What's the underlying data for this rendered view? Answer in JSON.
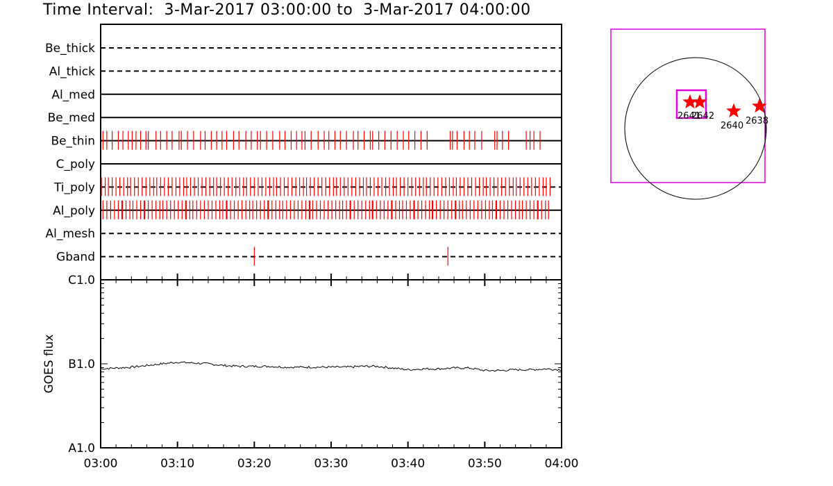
{
  "title": "Time Interval:  3-Mar-2017 03:00:00 to  3-Mar-2017 04:00:00",
  "chart_data": [
    {
      "type": "timeline",
      "xlim": [
        "03:00",
        "04:00"
      ],
      "channels": [
        {
          "label": "Be_thick",
          "style": "dashed",
          "events": []
        },
        {
          "label": "Al_thick",
          "style": "dashed",
          "events": []
        },
        {
          "label": "Al_med",
          "style": "solid",
          "events": []
        },
        {
          "label": "Be_med",
          "style": "solid",
          "events": []
        },
        {
          "label": "Be_thin",
          "style": "solid",
          "events": [
            0.3,
            0.8,
            1.5,
            2.3,
            2.9,
            3.6,
            4.1,
            4.6,
            5.2,
            5.9,
            6.2,
            7.2,
            7.8,
            8.6,
            9.3,
            10.2,
            10.5,
            11.3,
            12.1,
            13.0,
            13.6,
            14.4,
            15.1,
            15.8,
            16.4,
            17.3,
            18.0,
            18.9,
            19.6,
            20.4,
            20.8,
            21.6,
            22.4,
            23.3,
            24.0,
            24.8,
            25.5,
            26.2,
            26.6,
            27.4,
            28.3,
            29.1,
            29.7,
            30.5,
            31.2,
            32.0,
            32.9,
            33.5,
            34.3,
            35.1,
            35.4,
            36.2,
            37.0,
            37.8,
            38.6,
            39.4,
            40.1,
            40.9,
            41.7,
            42.5,
            45.5,
            45.8,
            46.4,
            47.3,
            48.0,
            48.7,
            49.6,
            51.3,
            51.6,
            52.3,
            53.1,
            55.4,
            55.9,
            56.4,
            57.2
          ]
        },
        {
          "label": "C_poly",
          "style": "solid",
          "events": []
        },
        {
          "label": "Ti_poly",
          "style": "dashed",
          "events": [
            0.1,
            0.6,
            1.0,
            1.5,
            2.0,
            2.5,
            3.0,
            3.5,
            3.9,
            4.4,
            4.9,
            5.4,
            5.9,
            6.4,
            6.9,
            7.3,
            7.8,
            8.3,
            8.8,
            9.3,
            9.8,
            10.3,
            10.8,
            11.2,
            11.7,
            12.2,
            12.7,
            13.2,
            13.7,
            14.2,
            14.7,
            15.1,
            15.6,
            16.1,
            16.6,
            17.1,
            17.6,
            18.1,
            18.6,
            19.0,
            19.5,
            20.0,
            20.5,
            21.0,
            21.5,
            22.0,
            22.5,
            22.9,
            23.4,
            23.9,
            24.4,
            24.9,
            25.4,
            25.9,
            26.4,
            26.8,
            27.3,
            27.8,
            28.3,
            28.8,
            29.3,
            29.8,
            30.3,
            30.7,
            31.2,
            31.7,
            32.2,
            32.7,
            33.2,
            33.7,
            34.2,
            34.6,
            35.1,
            35.6,
            36.1,
            36.6,
            37.1,
            37.6,
            38.1,
            38.5,
            39.0,
            39.5,
            40.0,
            40.5,
            41.0,
            41.5,
            42.0,
            42.4,
            42.9,
            43.4,
            43.9,
            44.4,
            44.9,
            45.4,
            45.9,
            46.3,
            46.8,
            47.3,
            47.8,
            48.3,
            48.8,
            49.3,
            49.8,
            50.2,
            50.7,
            51.2,
            51.7,
            52.2,
            52.7,
            53.2,
            53.7,
            54.1,
            54.6,
            55.1,
            55.6,
            56.1,
            56.6,
            57.1,
            57.6,
            58.0,
            58.5
          ]
        },
        {
          "label": "Al_poly",
          "style": "solid",
          "events": [
            0.3,
            0.8,
            1.3,
            1.8,
            2.3,
            2.8,
            3.3,
            3.8,
            4.2,
            4.7,
            5.2,
            5.7,
            6.2,
            6.7,
            7.2,
            7.7,
            8.1,
            8.6,
            9.1,
            9.6,
            10.1,
            10.6,
            11.1,
            11.6,
            12.0,
            12.5,
            13.0,
            13.5,
            14.0,
            14.5,
            15.0,
            15.5,
            15.9,
            16.4,
            16.9,
            17.4,
            17.9,
            18.4,
            18.9,
            19.4,
            19.8,
            20.3,
            20.8,
            21.3,
            21.8,
            22.3,
            22.8,
            23.3,
            23.7,
            24.2,
            24.7,
            25.2,
            25.7,
            26.2,
            26.7,
            27.2,
            27.6,
            28.1,
            28.6,
            29.1,
            29.6,
            30.1,
            30.6,
            31.1,
            31.5,
            32.0,
            32.5,
            33.0,
            33.5,
            34.0,
            34.5,
            35.0,
            35.4,
            35.9,
            36.4,
            36.9,
            37.4,
            37.9,
            38.4,
            38.9,
            39.3,
            39.8,
            40.3,
            40.8,
            41.3,
            41.8,
            42.3,
            42.8,
            43.2,
            43.7,
            44.2,
            44.7,
            45.2,
            45.7,
            46.2,
            46.7,
            47.1,
            47.6,
            48.1,
            48.6,
            49.1,
            49.6,
            50.1,
            50.6,
            51.0,
            51.5,
            52.0,
            52.5,
            53.0,
            53.5,
            54.0,
            54.5,
            54.9,
            55.4,
            55.9,
            56.4,
            56.9,
            57.4,
            57.9,
            58.3
          ]
        },
        {
          "label": "Al_mesh",
          "style": "dashed",
          "events": []
        },
        {
          "label": "Gband",
          "style": "dashed",
          "events": [
            20.0,
            45.2
          ]
        }
      ]
    },
    {
      "type": "line",
      "ylabel": "GOES flux",
      "yticks": [
        "C1.0",
        "B1.0",
        "A1.0"
      ],
      "xticks": [
        "03:00",
        "03:10",
        "03:20",
        "03:30",
        "03:40",
        "03:50",
        "04:00"
      ],
      "xlim": [
        0,
        60
      ],
      "ylim_log": [
        -8,
        -6
      ],
      "x": [
        0,
        2,
        4,
        6,
        8,
        10,
        12,
        14,
        16,
        18,
        20,
        22,
        24,
        26,
        28,
        30,
        32,
        34,
        36,
        38,
        40,
        42,
        44,
        46,
        48,
        50,
        52,
        54,
        56,
        58,
        60
      ],
      "y_log": [
        -7.06,
        -7.05,
        -7.04,
        -7.02,
        -7.0,
        -6.98,
        -6.99,
        -7.0,
        -7.02,
        -7.03,
        -7.03,
        -7.03,
        -7.04,
        -7.04,
        -7.04,
        -7.04,
        -7.04,
        -7.03,
        -7.03,
        -7.05,
        -7.07,
        -7.06,
        -7.06,
        -7.05,
        -7.05,
        -7.08,
        -7.08,
        -7.07,
        -7.07,
        -7.06,
        -7.07
      ]
    }
  ],
  "sun_map": {
    "active_regions": [
      {
        "label": "2641"
      },
      {
        "label": "2642"
      },
      {
        "label": "2640"
      },
      {
        "label": "2638"
      }
    ]
  }
}
